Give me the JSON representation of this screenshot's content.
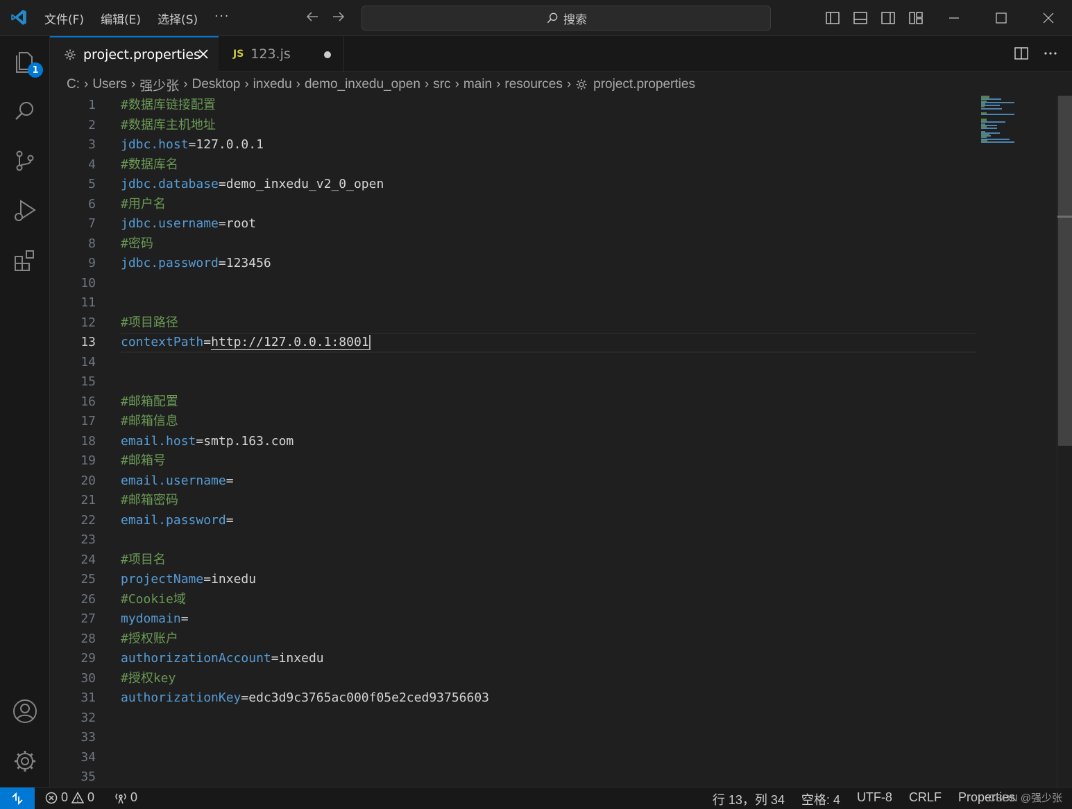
{
  "titlebar": {
    "menu": [
      "文件(F)",
      "编辑(E)",
      "选择(S)",
      "···"
    ],
    "search_placeholder": "搜索"
  },
  "activity": {
    "explorer_badge": "1"
  },
  "tabs": [
    {
      "label": "project.properties",
      "active": true
    },
    {
      "label": "123.js",
      "active": false,
      "modified": true,
      "icon_text": "JS"
    }
  ],
  "breadcrumb": [
    "C:",
    "Users",
    "强少张",
    "Desktop",
    "inxedu",
    "demo_inxedu_open",
    "src",
    "main",
    "resources",
    "project.properties"
  ],
  "editor": {
    "current_line": 13,
    "lines": [
      {
        "n": "1",
        "comment": "#数据库链接配置"
      },
      {
        "n": "2",
        "comment": "#数据库主机地址"
      },
      {
        "n": "3",
        "key": "jdbc.host",
        "value": "127.0.0.1"
      },
      {
        "n": "4",
        "comment": "#数据库名"
      },
      {
        "n": "5",
        "key": "jdbc.database",
        "value": "demo_inxedu_v2_0_open"
      },
      {
        "n": "6",
        "comment": "#用户名"
      },
      {
        "n": "7",
        "key": "jdbc.username",
        "value": "root"
      },
      {
        "n": "8",
        "comment": "#密码"
      },
      {
        "n": "9",
        "key": "jdbc.password",
        "value": "123456"
      },
      {
        "n": "10"
      },
      {
        "n": "11"
      },
      {
        "n": "12",
        "comment": "#项目路径"
      },
      {
        "n": "13",
        "key": "contextPath",
        "value": "http://127.0.0.1:8001"
      },
      {
        "n": "14"
      },
      {
        "n": "15"
      },
      {
        "n": "16",
        "comment": "#邮箱配置"
      },
      {
        "n": "17",
        "comment": "#邮箱信息"
      },
      {
        "n": "18",
        "key": "email.host",
        "value": "smtp.163.com"
      },
      {
        "n": "19",
        "comment": "#邮箱号"
      },
      {
        "n": "20",
        "key": "email.username",
        "value": ""
      },
      {
        "n": "21",
        "comment": "#邮箱密码"
      },
      {
        "n": "22",
        "key": "email.password",
        "value": ""
      },
      {
        "n": "23"
      },
      {
        "n": "24",
        "comment": "#项目名"
      },
      {
        "n": "25",
        "key": "projectName",
        "value": "inxedu"
      },
      {
        "n": "26",
        "comment": "#Cookie域"
      },
      {
        "n": "27",
        "key": "mydomain",
        "value": ""
      },
      {
        "n": "28",
        "comment": "#授权账户"
      },
      {
        "n": "29",
        "key": "authorizationAccount",
        "value": "inxedu"
      },
      {
        "n": "30",
        "comment": "#授权key"
      },
      {
        "n": "31",
        "key": "authorizationKey",
        "value": "edc3d9c3765ac000f05e2ced93756603"
      },
      {
        "n": "32"
      },
      {
        "n": "33"
      },
      {
        "n": "34"
      },
      {
        "n": "35"
      }
    ]
  },
  "status": {
    "errors": "0",
    "warnings": "0",
    "ports": "0",
    "position": "行 13，列 34",
    "spaces": "空格: 4",
    "encoding": "UTF-8",
    "eol": "CRLF",
    "language": "Properties",
    "watermark": "CSDN @强少张"
  },
  "colors": {
    "accent": "#0078d4",
    "key": "#569cd6",
    "comment": "#6a9955"
  }
}
